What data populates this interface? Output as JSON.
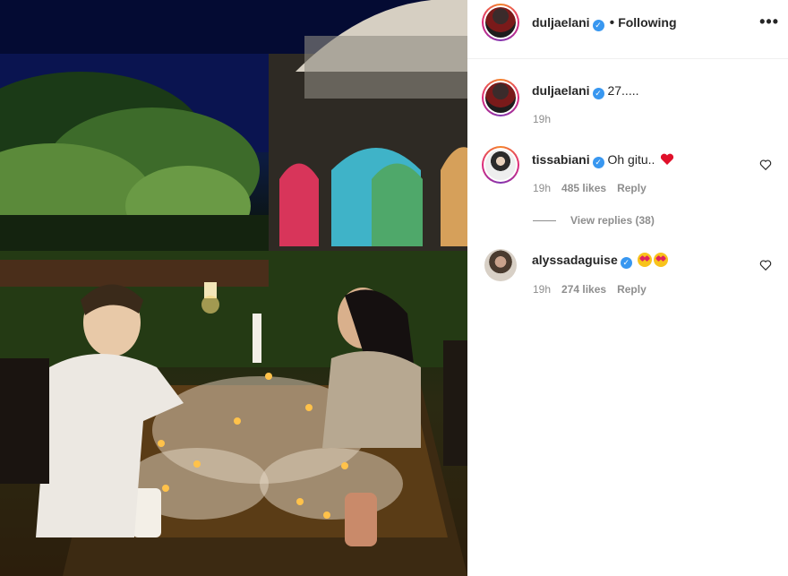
{
  "header": {
    "username": "duljaelani",
    "separator": "•",
    "follow_status": "Following",
    "more_label": "•••"
  },
  "caption": {
    "username": "duljaelani",
    "text": "27.....",
    "time": "19h"
  },
  "comments": [
    {
      "username": "tissabiani",
      "text": "Oh gitu..",
      "emoji": "red-heart-emoji",
      "time": "19h",
      "likes": "485 likes",
      "reply_label": "Reply",
      "view_replies": "View replies (38)"
    },
    {
      "username": "alyssadaguise",
      "text": "",
      "emoji": "star-struck-emoji",
      "time": "19h",
      "likes": "274 likes",
      "reply_label": "Reply"
    }
  ],
  "colors": {
    "text": "#262626",
    "secondary": "#8e8e8e",
    "verified": "#3897f0",
    "heart": "#ed4956"
  }
}
